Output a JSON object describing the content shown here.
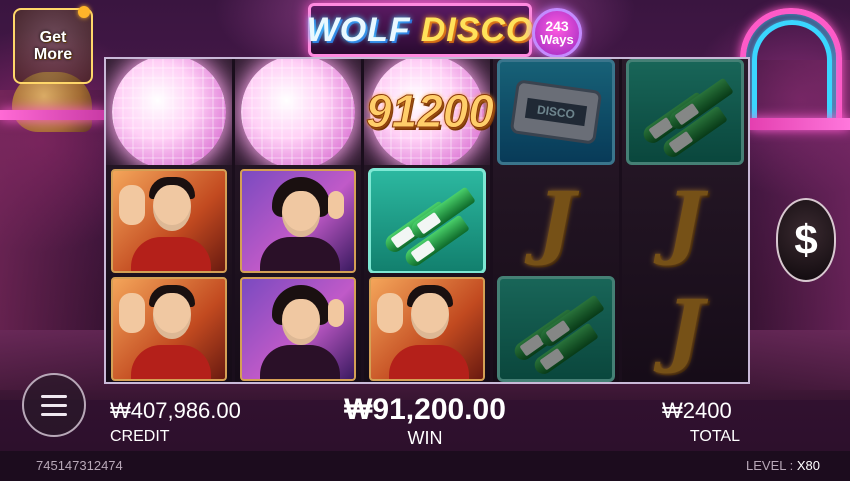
{
  "logo": {
    "wolf": "WOLF",
    "disco": "DISCO"
  },
  "ways": {
    "number": "243",
    "label": "Ways"
  },
  "get_more": "Get\nMore",
  "reels": [
    [
      {
        "symbol": "disco-ball",
        "dim": false
      },
      {
        "symbol": "man",
        "dim": false
      },
      {
        "symbol": "man",
        "dim": false
      }
    ],
    [
      {
        "symbol": "disco-ball",
        "dim": false
      },
      {
        "symbol": "woman",
        "dim": false
      },
      {
        "symbol": "woman",
        "dim": false
      }
    ],
    [
      {
        "symbol": "disco-ball",
        "dim": false
      },
      {
        "symbol": "bottles",
        "dim": false
      },
      {
        "symbol": "man",
        "dim": false
      }
    ],
    [
      {
        "symbol": "pager",
        "dim": true,
        "text": "DISCO"
      },
      {
        "symbol": "J",
        "dim": true
      },
      {
        "symbol": "bottles",
        "dim": true
      }
    ],
    [
      {
        "symbol": "bottles",
        "dim": true
      },
      {
        "symbol": "J",
        "dim": true
      },
      {
        "symbol": "J",
        "dim": true
      }
    ]
  ],
  "win_popup": "91200",
  "bet_button_symbol": "$",
  "credit": {
    "value": "₩407,986.00",
    "label": "CREDIT"
  },
  "win": {
    "value": "₩91,200.00",
    "label": "WIN"
  },
  "total": {
    "value": "₩2400",
    "label": "TOTAL"
  },
  "round_id": "745147312474",
  "level": {
    "label": "LEVEL :",
    "value": "X80"
  }
}
